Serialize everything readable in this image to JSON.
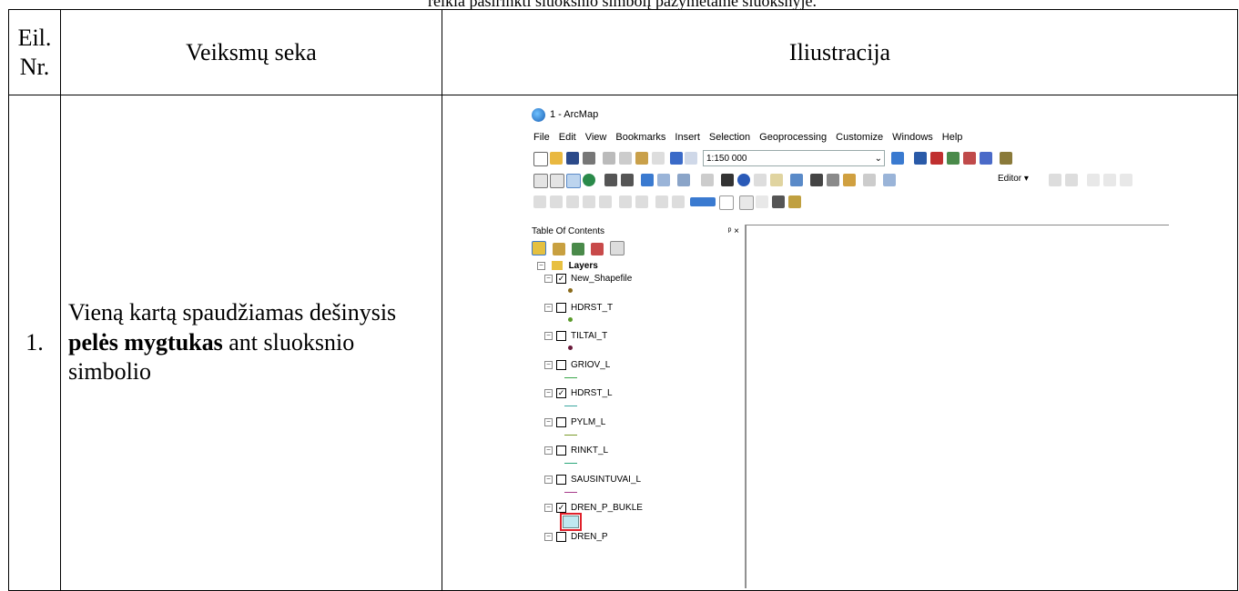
{
  "top_text": "reikia pasirinkti sluoksnio simbolį pažymėtame sluoksnyje.",
  "table": {
    "header": {
      "col1": "Eil. Nr.",
      "col2": "Veiksmų seka",
      "col3": "Iliustracija"
    },
    "row1": {
      "num": "1.",
      "desc_prefix": "Vieną kartą spaudžiamas dešinysis ",
      "desc_bold": "pelės mygtukas",
      "desc_suffix": " ant sluoksnio simbolio"
    }
  },
  "arcmap": {
    "title": "1 - ArcMap",
    "menu": [
      "File",
      "Edit",
      "View",
      "Bookmarks",
      "Insert",
      "Selection",
      "Geoprocessing",
      "Customize",
      "Windows",
      "Help"
    ],
    "scale": "1:150 000",
    "editor_label": "Editor ▾",
    "toc_title": "Table Of Contents",
    "pin_close": "ᵖ ×",
    "layers_group": "Layers",
    "layers": [
      {
        "name": "New_Shapefile",
        "checked": true,
        "symbol": "point",
        "color": "#8a6a1a"
      },
      {
        "name": "HDRST_T",
        "checked": false,
        "symbol": "point",
        "color": "#5a9a2a"
      },
      {
        "name": "TILTAI_T",
        "checked": false,
        "symbol": "point",
        "color": "#6a1a3a"
      },
      {
        "name": "GRIOV_L",
        "checked": false,
        "symbol": "line",
        "color": "#3aa64a"
      },
      {
        "name": "HDRST_L",
        "checked": true,
        "symbol": "line",
        "color": "#3aa6a0"
      },
      {
        "name": "PYLM_L",
        "checked": false,
        "symbol": "line",
        "color": "#7a9a2a"
      },
      {
        "name": "RINKT_L",
        "checked": false,
        "symbol": "line",
        "color": "#2aa67a"
      },
      {
        "name": "SAUSINTUVAI_L",
        "checked": false,
        "symbol": "line",
        "color": "#a63a8a"
      },
      {
        "name": "DREN_P_BUKLE",
        "checked": true,
        "symbol": "polygon",
        "color": "#bfe8f0"
      },
      {
        "name": "DREN_P",
        "checked": false,
        "symbol": "none",
        "color": "#000000"
      }
    ],
    "highlight_color": "#e0202a"
  }
}
